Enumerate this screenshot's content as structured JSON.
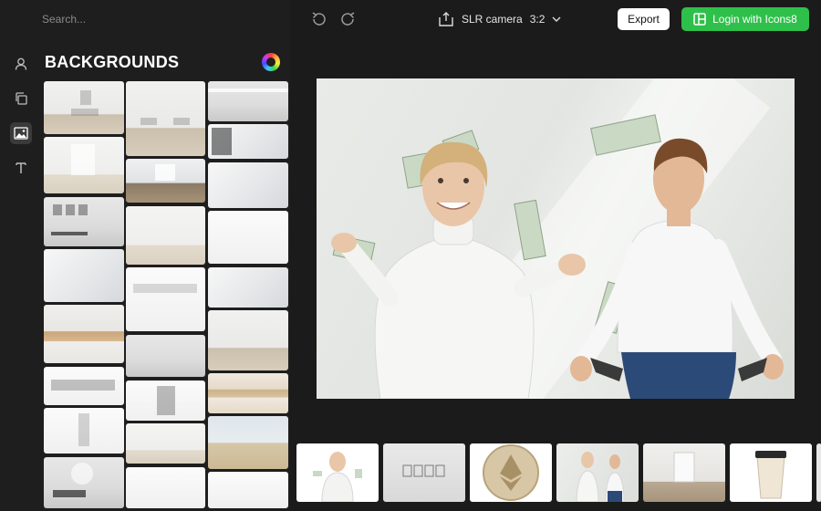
{
  "search": {
    "placeholder": "Search..."
  },
  "sidebar": {
    "rail": [
      {
        "icon": "person-icon",
        "label": "Person"
      },
      {
        "icon": "copy-icon",
        "label": "Objects"
      },
      {
        "icon": "image-icon",
        "label": "Backgrounds",
        "active": true
      },
      {
        "icon": "text-icon",
        "label": "Text"
      }
    ]
  },
  "panel": {
    "title": "BACKGROUNDS",
    "icon": "color-wheel-icon"
  },
  "topbar": {
    "undo_icon": "undo-icon",
    "redo_icon": "redo-icon",
    "share_icon": "share-icon",
    "camera": "SLR camera",
    "ratio": "3:2",
    "export_label": "Export",
    "login_label": "Login with Icons8"
  },
  "colors": {
    "accent": "#2ec04a",
    "background": "#1b1b1b",
    "panel": "#1e1e1e"
  }
}
